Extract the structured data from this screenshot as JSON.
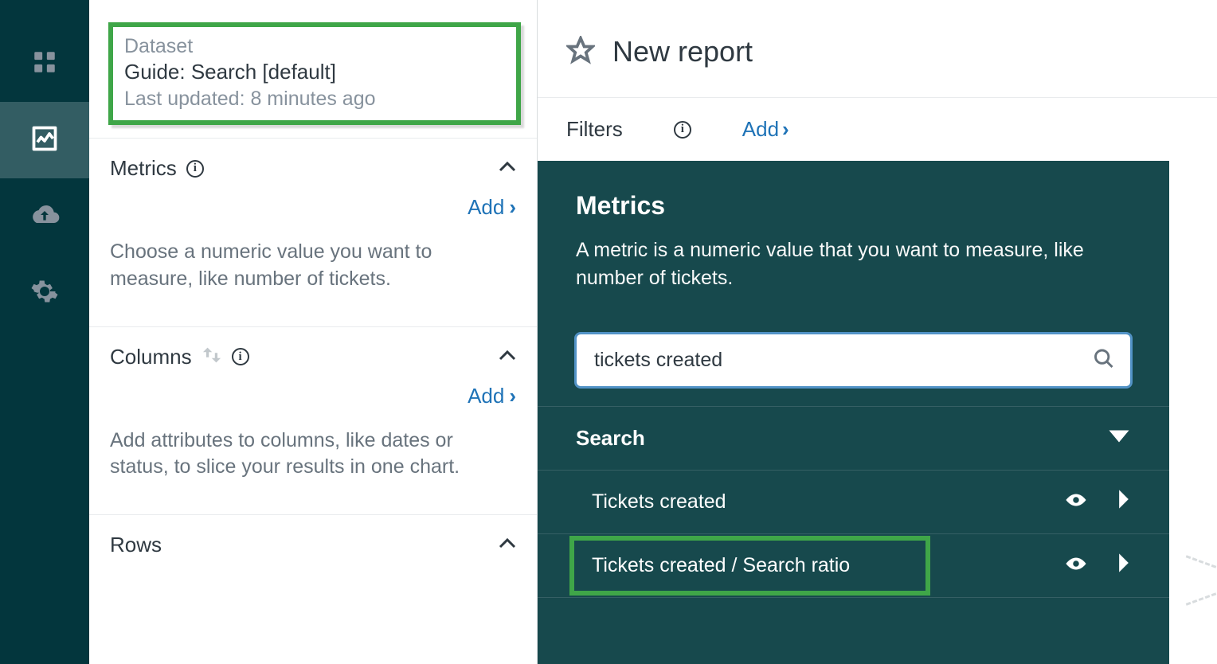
{
  "nav": {
    "items": [
      "dashboard",
      "reports",
      "upload",
      "settings"
    ],
    "active_index": 1
  },
  "dataset": {
    "label": "Dataset",
    "name": "Guide: Search [default]",
    "updated": "Last updated: 8 minutes ago"
  },
  "sections": {
    "metrics": {
      "title": "Metrics",
      "add": "Add",
      "desc": "Choose a numeric value you want to measure, like number of tickets."
    },
    "columns": {
      "title": "Columns",
      "add": "Add",
      "desc": "Add attributes to columns, like dates or status, to slice your results in one chart."
    },
    "rows": {
      "title": "Rows"
    }
  },
  "report": {
    "title": "New report"
  },
  "filters": {
    "label": "Filters",
    "add": "Add"
  },
  "picker": {
    "title": "Metrics",
    "desc": "A metric is a numeric value that you want to measure, like number of tickets.",
    "search_value": "tickets created",
    "group": "Search",
    "items": [
      {
        "label": "Tickets created",
        "highlight": false
      },
      {
        "label": "Tickets created / Search ratio",
        "highlight": true
      }
    ]
  }
}
